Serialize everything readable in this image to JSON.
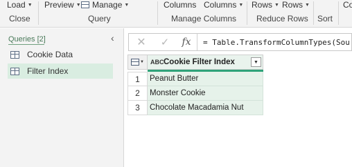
{
  "ribbon": {
    "buttons": {
      "load": "Load",
      "preview": "Preview",
      "manage": "Manage",
      "columns_choose": "Columns",
      "columns_remove": "Columns",
      "rows_keep": "Rows",
      "rows_remove": "Rows",
      "co_partial": "Co"
    },
    "groups": {
      "close": "Close",
      "query": "Query",
      "manage_columns": "Manage Columns",
      "reduce_rows": "Reduce Rows",
      "sort": "Sort"
    }
  },
  "queries_pane": {
    "header": "Queries [2]",
    "collapse_glyph": "‹",
    "items": [
      {
        "label": "Cookie Data",
        "selected": false
      },
      {
        "label": "Filter Index",
        "selected": true
      }
    ]
  },
  "formula_bar": {
    "cancel_glyph": "✕",
    "commit_glyph": "✓",
    "fx_label": "fx",
    "formula": "= Table.TransformColumnTypes(Sou"
  },
  "grid": {
    "column_header": "Cookie Filter Index",
    "type_icon": "ABC",
    "rows": [
      {
        "index": "1",
        "value": "Peanut Butter"
      },
      {
        "index": "2",
        "value": "Monster Cookie"
      },
      {
        "index": "3",
        "value": "Chocolate Macadamia Nut"
      }
    ]
  },
  "colors": {
    "selected_query_bg": "#d9ede1",
    "column_accent": "#2fa37a",
    "cell_bg": "#e6f2ea"
  }
}
